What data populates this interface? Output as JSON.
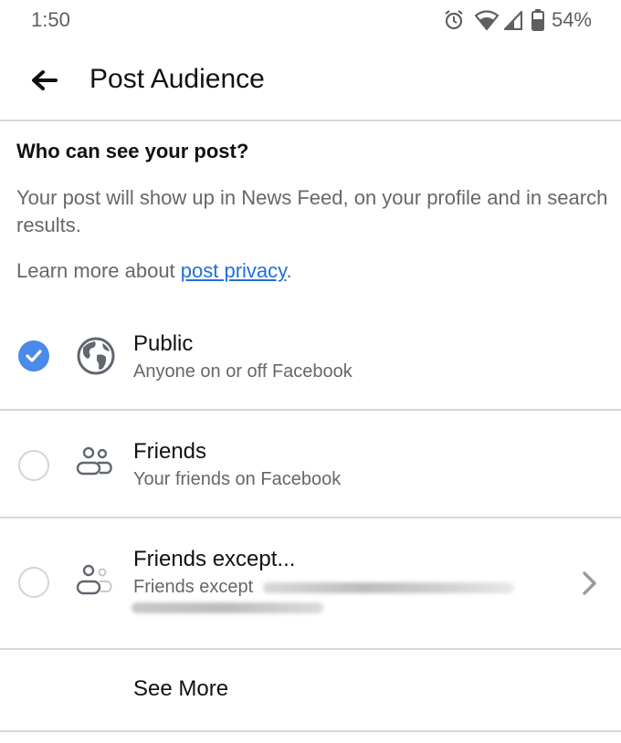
{
  "status_bar": {
    "time": "1:50",
    "icons": [
      "alarm-icon",
      "wifi-icon",
      "signal-icon",
      "battery-icon"
    ],
    "battery_percent": "54%"
  },
  "app_bar": {
    "back_icon": "arrow-left-icon",
    "title": "Post Audience"
  },
  "content": {
    "heading": "Who can see your post?",
    "description": "Your post will show up in News Feed, on your profile and in search results.",
    "learn_more_prefix": "Learn more about ",
    "learn_more_link": "post privacy",
    "learn_more_suffix": "."
  },
  "accent_color": "#4a8ae8",
  "link_color": "#216fdb",
  "options": [
    {
      "title": "Public",
      "subtitle": "Anyone on or off Facebook",
      "icon": "globe-icon",
      "selected": true
    },
    {
      "title": "Friends",
      "subtitle": "Your friends on Facebook",
      "icon": "friends-icon",
      "selected": false
    },
    {
      "title": "Friends except...",
      "subtitle": "Friends except",
      "icon": "friends-except-icon",
      "selected": false,
      "has_chevron": true,
      "subtitle_redacted": true
    }
  ],
  "see_more_label": "See More"
}
